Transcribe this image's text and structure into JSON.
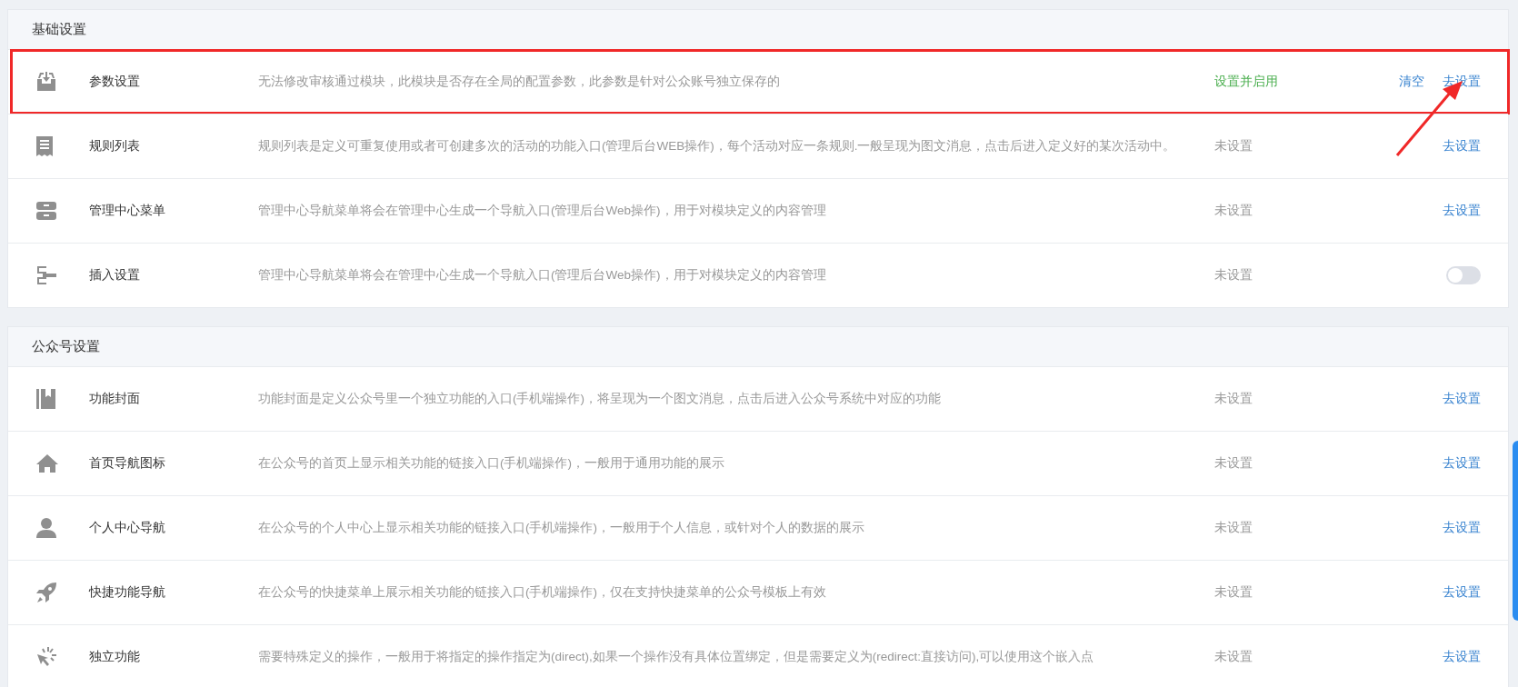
{
  "sections": [
    {
      "title": "基础设置",
      "rows": [
        {
          "title": "参数设置",
          "description": "无法修改审核通过模块，此模块是否存在全局的配置参数，此参数是针对公众账号独立保存的",
          "status": "设置并启用",
          "enabled": true,
          "annotated": true,
          "kind": "links",
          "actions": [
            "清空",
            "去设置"
          ]
        },
        {
          "title": "规则列表",
          "description": "规则列表是定义可重复使用或者可创建多次的活动的功能入口(管理后台WEB操作)，每个活动对应一条规则.一般呈现为图文消息，点击后进入定义好的某次活动中。",
          "status": "未设置",
          "enabled": false,
          "annotated": false,
          "kind": "links",
          "actions": [
            "去设置"
          ]
        },
        {
          "title": "管理中心菜单",
          "description": "管理中心导航菜单将会在管理中心生成一个导航入口(管理后台Web操作)，用于对模块定义的内容管理",
          "status": "未设置",
          "enabled": false,
          "annotated": false,
          "kind": "links",
          "actions": [
            "去设置"
          ]
        },
        {
          "title": "插入设置",
          "description": "管理中心导航菜单将会在管理中心生成一个导航入口(管理后台Web操作)，用于对模块定义的内容管理",
          "status": "未设置",
          "enabled": false,
          "annotated": false,
          "kind": "toggle",
          "on": false
        }
      ]
    },
    {
      "title": "公众号设置",
      "rows": [
        {
          "title": "功能封面",
          "description": "功能封面是定义公众号里一个独立功能的入口(手机端操作)，将呈现为一个图文消息，点击后进入公众号系统中对应的功能",
          "status": "未设置",
          "enabled": false,
          "annotated": false,
          "kind": "links",
          "actions": [
            "去设置"
          ]
        },
        {
          "title": "首页导航图标",
          "description": "在公众号的首页上显示相关功能的链接入口(手机端操作)，一般用于通用功能的展示",
          "status": "未设置",
          "enabled": false,
          "annotated": false,
          "kind": "links",
          "actions": [
            "去设置"
          ]
        },
        {
          "title": "个人中心导航",
          "description": "在公众号的个人中心上显示相关功能的链接入口(手机端操作)，一般用于个人信息，或针对个人的数据的展示",
          "status": "未设置",
          "enabled": false,
          "annotated": false,
          "kind": "links",
          "actions": [
            "去设置"
          ]
        },
        {
          "title": "快捷功能导航",
          "description": "在公众号的快捷菜单上展示相关功能的链接入口(手机端操作)，仅在支持快捷菜单的公众号模板上有效",
          "status": "未设置",
          "enabled": false,
          "annotated": false,
          "kind": "links",
          "actions": [
            "去设置"
          ]
        },
        {
          "title": "独立功能",
          "description": "需要特殊定义的操作，一般用于将指定的操作指定为(direct),如果一个操作没有具体位置绑定，但是需要定义为(redirect:直接访问),可以使用这个嵌入点",
          "status": "未设置",
          "enabled": false,
          "annotated": false,
          "kind": "links",
          "actions": [
            "去设置"
          ]
        }
      ]
    }
  ]
}
